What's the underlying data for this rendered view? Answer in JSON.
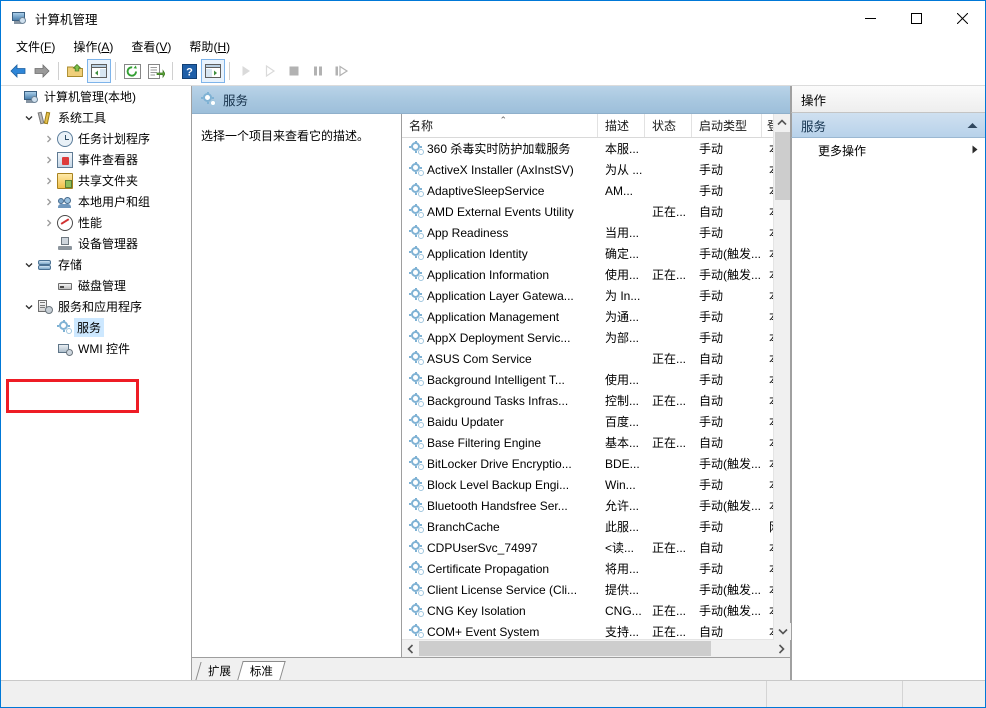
{
  "window": {
    "title": "计算机管理",
    "icon": "computer-management-icon",
    "controls": {
      "minimize": "—",
      "maximize": "□",
      "close": "✕"
    }
  },
  "menubar": [
    {
      "label": "文件",
      "accel": "F"
    },
    {
      "label": "操作",
      "accel": "A"
    },
    {
      "label": "查看",
      "accel": "V"
    },
    {
      "label": "帮助",
      "accel": "H"
    }
  ],
  "toolbar": {
    "buttons": [
      {
        "name": "back-icon",
        "enabled": true
      },
      {
        "name": "forward-icon",
        "enabled": true
      },
      {
        "name": "up-folder-icon",
        "enabled": true
      },
      {
        "name": "show-hide-tree-icon",
        "enabled": true,
        "framed": true
      },
      {
        "name": "refresh-icon",
        "enabled": true
      },
      {
        "name": "export-list-icon",
        "enabled": true
      },
      {
        "name": "help-icon",
        "enabled": true
      },
      {
        "name": "show-action-pane-icon",
        "enabled": true,
        "framed": true
      },
      {
        "name": "start-service-icon",
        "enabled": false
      },
      {
        "name": "resume-service-icon",
        "enabled": false
      },
      {
        "name": "stop-service-icon",
        "enabled": false
      },
      {
        "name": "pause-service-icon",
        "enabled": false
      },
      {
        "name": "restart-service-icon",
        "enabled": false
      }
    ]
  },
  "tree": {
    "nodes": [
      {
        "label": "计算机管理(本地)",
        "icon": "computer-icon",
        "indent": 0,
        "expander": "none",
        "selected": false
      },
      {
        "label": "系统工具",
        "icon": "system-tools-icon",
        "indent": 1,
        "expander": "expanded",
        "selected": false
      },
      {
        "label": "任务计划程序",
        "icon": "task-scheduler-icon",
        "indent": 2,
        "expander": "collapsed",
        "selected": false
      },
      {
        "label": "事件查看器",
        "icon": "event-viewer-icon",
        "indent": 2,
        "expander": "collapsed",
        "selected": false
      },
      {
        "label": "共享文件夹",
        "icon": "shared-folders-icon",
        "indent": 2,
        "expander": "collapsed",
        "selected": false
      },
      {
        "label": "本地用户和组",
        "icon": "local-users-icon",
        "indent": 2,
        "expander": "collapsed",
        "selected": false
      },
      {
        "label": "性能",
        "icon": "performance-icon",
        "indent": 2,
        "expander": "collapsed",
        "selected": false
      },
      {
        "label": "设备管理器",
        "icon": "device-manager-icon",
        "indent": 2,
        "expander": "none",
        "selected": false
      },
      {
        "label": "存储",
        "icon": "storage-icon",
        "indent": 1,
        "expander": "expanded",
        "selected": false
      },
      {
        "label": "磁盘管理",
        "icon": "disk-management-icon",
        "indent": 2,
        "expander": "none",
        "selected": false
      },
      {
        "label": "服务和应用程序",
        "icon": "services-apps-icon",
        "indent": 1,
        "expander": "expanded",
        "selected": false
      },
      {
        "label": "服务",
        "icon": "service-gear-icon",
        "indent": 2,
        "expander": "none",
        "selected": true
      },
      {
        "label": "WMI 控件",
        "icon": "wmi-control-icon",
        "indent": 2,
        "expander": "none",
        "selected": false
      }
    ],
    "annotation": {
      "type": "red-rectangle",
      "color": "#ee1c25"
    }
  },
  "content": {
    "header_title": "服务",
    "header_icon": "service-gear-icon",
    "description_placeholder": "选择一个项目来查看它的描述。",
    "columns": [
      {
        "key": "name",
        "label": "名称",
        "sorted": "asc"
      },
      {
        "key": "desc",
        "label": "描述"
      },
      {
        "key": "stat",
        "label": "状态"
      },
      {
        "key": "start",
        "label": "启动类型"
      },
      {
        "key": "logon",
        "label": "登"
      }
    ],
    "rows": [
      {
        "name": "360 杀毒实时防护加载服务",
        "desc": "本服...",
        "stat": "",
        "start": "手动",
        "logon": "本"
      },
      {
        "name": "ActiveX Installer (AxInstSV)",
        "desc": "为从 ...",
        "stat": "",
        "start": "手动",
        "logon": "本"
      },
      {
        "name": "AdaptiveSleepService",
        "desc": "AM...",
        "stat": "",
        "start": "手动",
        "logon": "本"
      },
      {
        "name": "AMD External Events Utility",
        "desc": "",
        "stat": "正在...",
        "start": "自动",
        "logon": "本"
      },
      {
        "name": "App Readiness",
        "desc": "当用...",
        "stat": "",
        "start": "手动",
        "logon": "本"
      },
      {
        "name": "Application Identity",
        "desc": "确定...",
        "stat": "",
        "start": "手动(触发...",
        "logon": "本"
      },
      {
        "name": "Application Information",
        "desc": "使用...",
        "stat": "正在...",
        "start": "手动(触发...",
        "logon": "本"
      },
      {
        "name": "Application Layer Gatewa...",
        "desc": "为 In...",
        "stat": "",
        "start": "手动",
        "logon": "本"
      },
      {
        "name": "Application Management",
        "desc": "为通...",
        "stat": "",
        "start": "手动",
        "logon": "本"
      },
      {
        "name": "AppX Deployment Servic...",
        "desc": "为部...",
        "stat": "",
        "start": "手动",
        "logon": "本"
      },
      {
        "name": "ASUS Com Service",
        "desc": "",
        "stat": "正在...",
        "start": "自动",
        "logon": "本"
      },
      {
        "name": "Background Intelligent T...",
        "desc": "使用...",
        "stat": "",
        "start": "手动",
        "logon": "本"
      },
      {
        "name": "Background Tasks Infras...",
        "desc": "控制...",
        "stat": "正在...",
        "start": "自动",
        "logon": "本"
      },
      {
        "name": "Baidu Updater",
        "desc": "百度...",
        "stat": "",
        "start": "手动",
        "logon": "本"
      },
      {
        "name": "Base Filtering Engine",
        "desc": "基本...",
        "stat": "正在...",
        "start": "自动",
        "logon": "本"
      },
      {
        "name": "BitLocker Drive Encryptio...",
        "desc": "BDE...",
        "stat": "",
        "start": "手动(触发...",
        "logon": "本"
      },
      {
        "name": "Block Level Backup Engi...",
        "desc": "Win...",
        "stat": "",
        "start": "手动",
        "logon": "本"
      },
      {
        "name": "Bluetooth Handsfree Ser...",
        "desc": "允许...",
        "stat": "",
        "start": "手动(触发...",
        "logon": "本"
      },
      {
        "name": "BranchCache",
        "desc": "此服...",
        "stat": "",
        "start": "手动",
        "logon": "网"
      },
      {
        "name": "CDPUserSvc_74997",
        "desc": "<读...",
        "stat": "正在...",
        "start": "自动",
        "logon": "本"
      },
      {
        "name": "Certificate Propagation",
        "desc": "将用...",
        "stat": "",
        "start": "手动",
        "logon": "本"
      },
      {
        "name": "Client License Service (Cli...",
        "desc": "提供...",
        "stat": "",
        "start": "手动(触发...",
        "logon": "本"
      },
      {
        "name": "CNG Key Isolation",
        "desc": "CNG...",
        "stat": "正在...",
        "start": "手动(触发...",
        "logon": "本"
      },
      {
        "name": "COM+ Event System",
        "desc": "支持...",
        "stat": "正在...",
        "start": "自动",
        "logon": "本"
      }
    ],
    "tabs": [
      {
        "label": "扩展",
        "active": false
      },
      {
        "label": "标准",
        "active": true
      }
    ]
  },
  "actions": {
    "header": "操作",
    "group_title": "服务",
    "collapse_icon": "chevron-up-icon",
    "items": [
      {
        "label": "更多操作",
        "submenu_icon": "chevron-right-icon"
      }
    ]
  },
  "statusbar": {
    "cells": [
      "",
      "",
      ""
    ]
  }
}
